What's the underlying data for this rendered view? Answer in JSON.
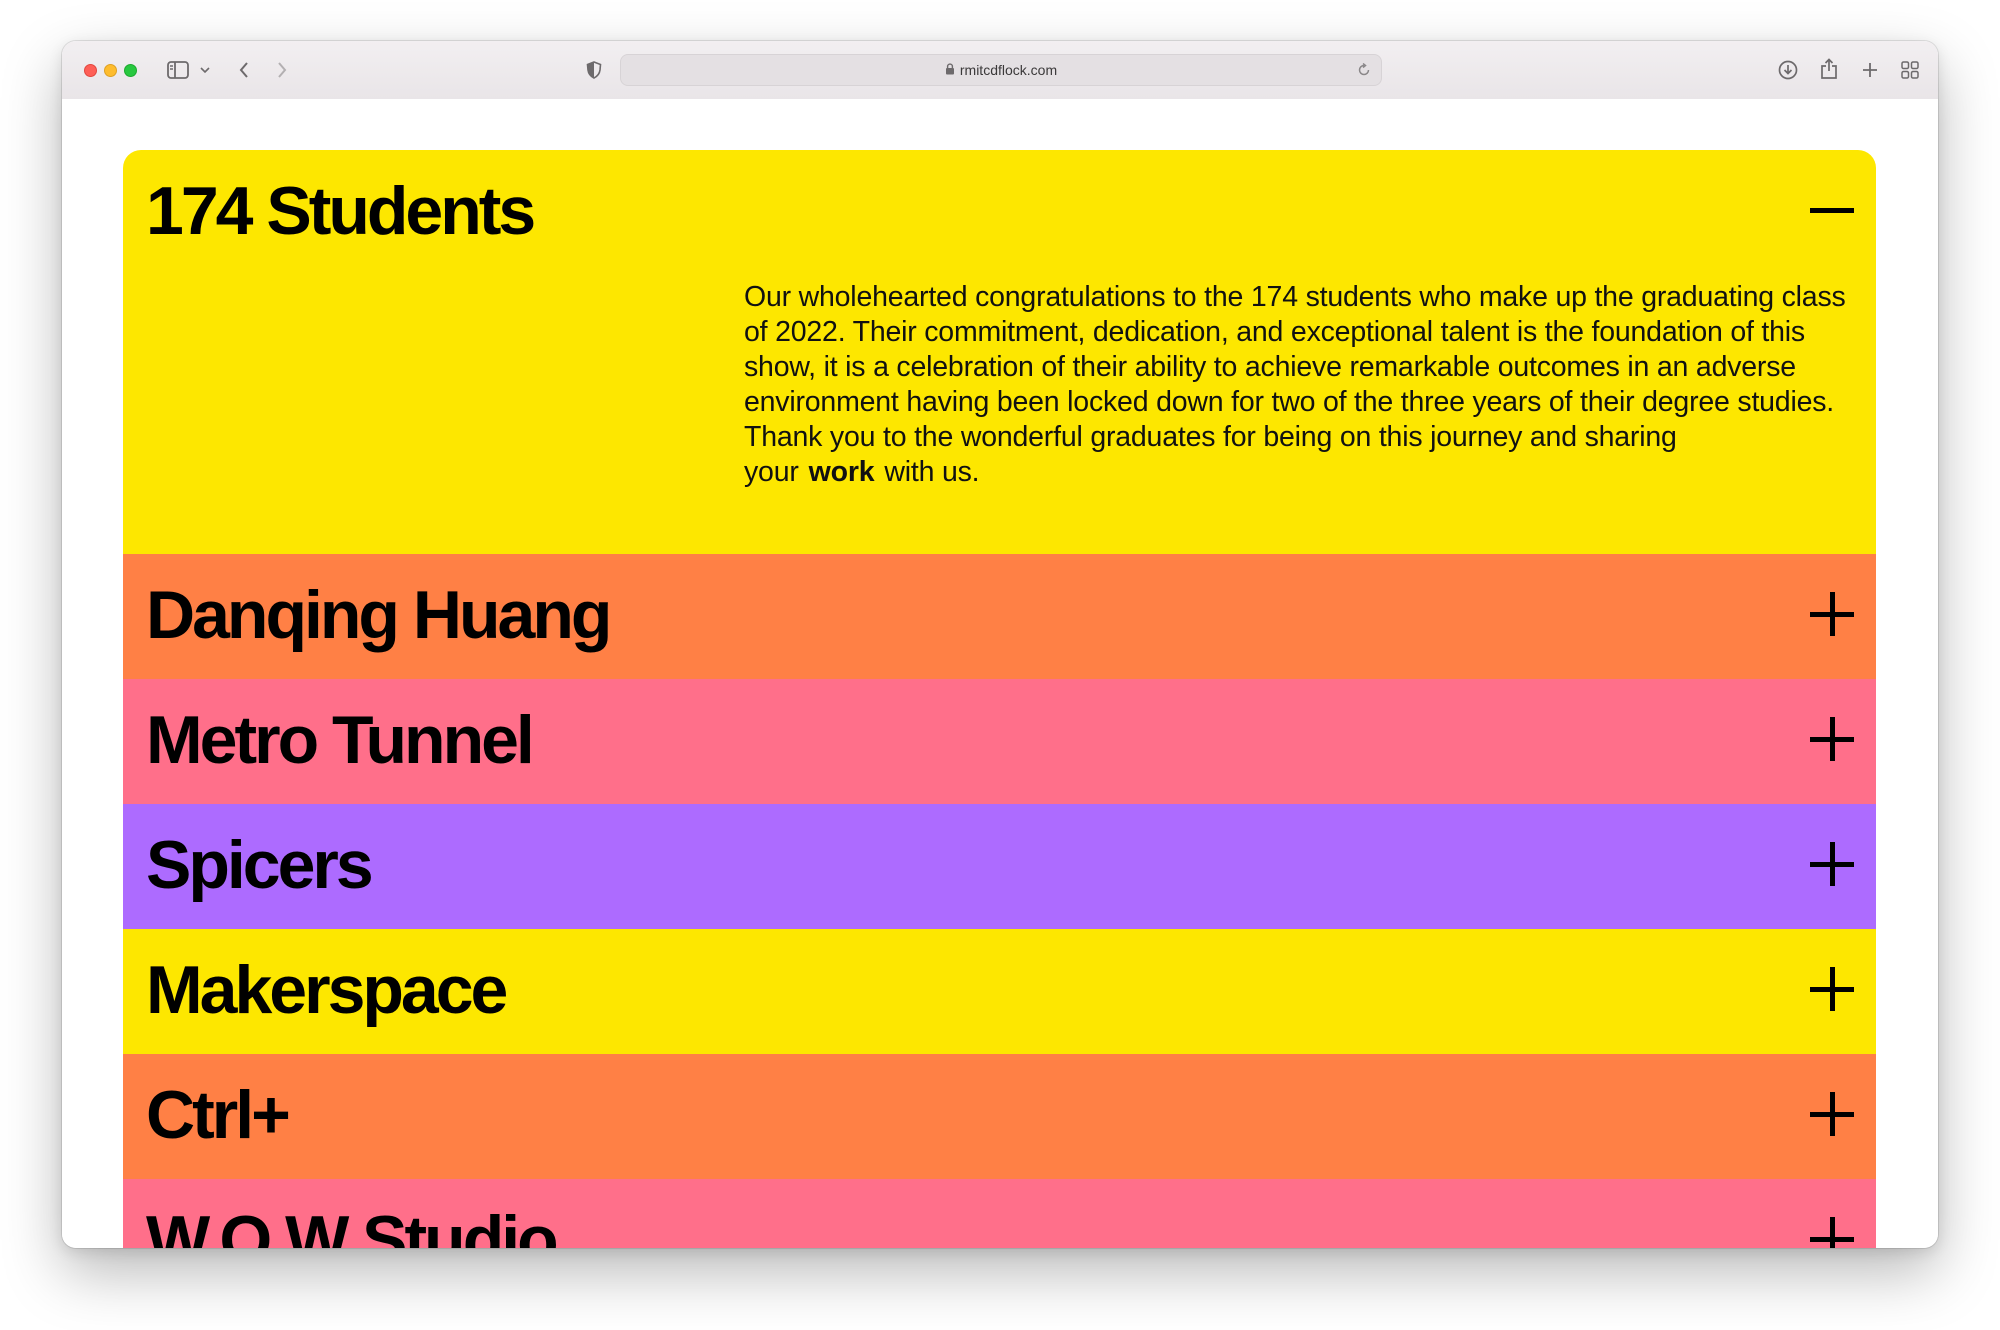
{
  "browser": {
    "url": "rmitcdflock.com"
  },
  "colors": {
    "yellow": "#fde700",
    "orange": "#ff8045",
    "pink": "#ff6f8a",
    "purple": "#ad6bff"
  },
  "panels": [
    {
      "title": "174 Students",
      "color": "#fde700",
      "expanded": true,
      "toggle_icon": "minus-icon",
      "body_before": "Our wholehearted congratulations to the 174 students who make up the graduating class of 2022. Their commitment, dedication, and exceptional talent is the foundation of this show, it is a celebration of their ability to achieve remarkable outcomes in an adverse environment having been locked down for two of the three years of their degree studies. Thank you to the wonderful graduates for being on this journey and sharing your",
      "body_link": "work",
      "body_after": "with us."
    },
    {
      "title": "Danqing Huang",
      "color": "#ff8045",
      "expanded": false,
      "toggle_icon": "plus-icon"
    },
    {
      "title": "Metro Tunnel",
      "color": "#ff6f8a",
      "expanded": false,
      "toggle_icon": "plus-icon"
    },
    {
      "title": "Spicers",
      "color": "#ad6bff",
      "expanded": false,
      "toggle_icon": "plus-icon"
    },
    {
      "title": "Makerspace",
      "color": "#fde700",
      "expanded": false,
      "toggle_icon": "plus-icon"
    },
    {
      "title": "Ctrl+",
      "color": "#ff8045",
      "expanded": false,
      "toggle_icon": "plus-icon"
    },
    {
      "title": "W.O.W Studio",
      "color": "#ff6f8a",
      "expanded": false,
      "toggle_icon": "plus-icon"
    }
  ]
}
